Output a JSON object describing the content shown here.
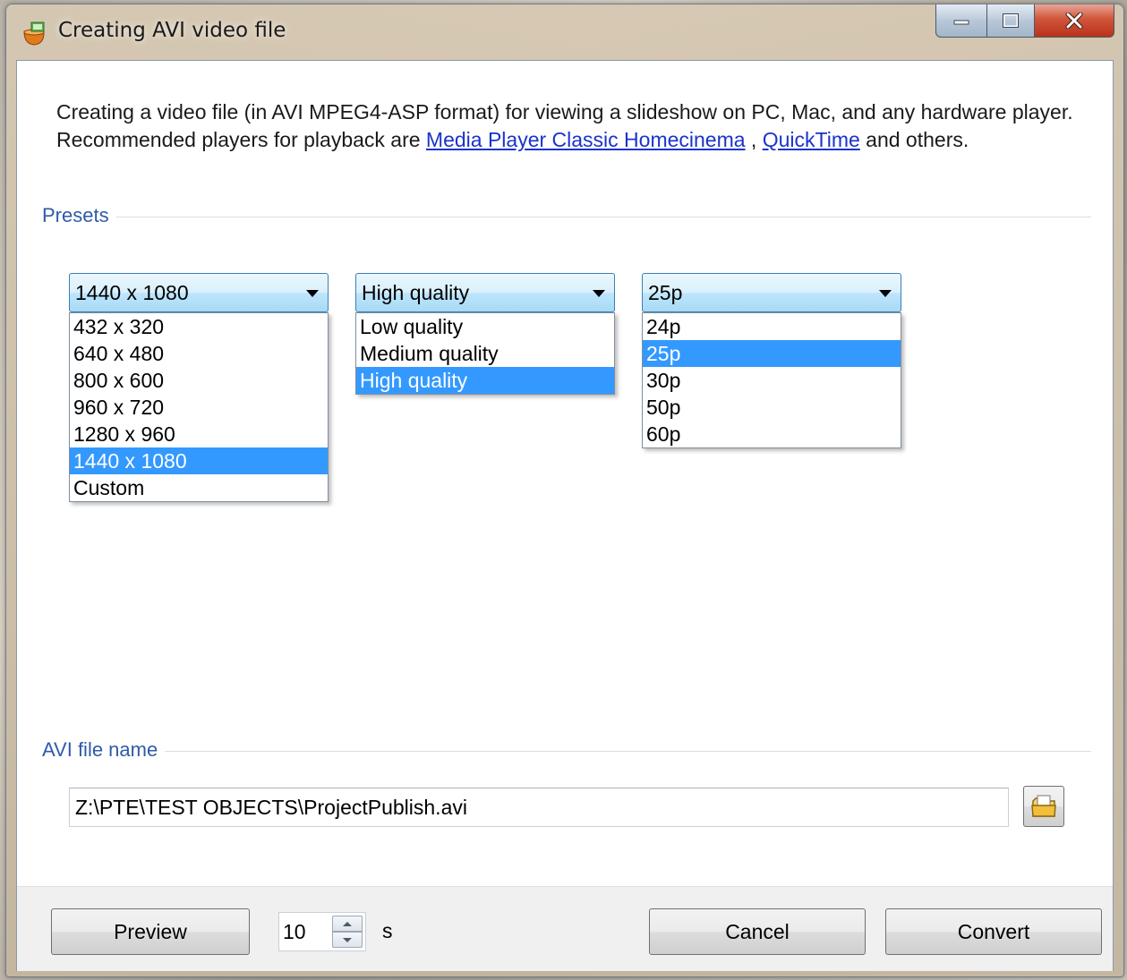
{
  "window": {
    "title": "Creating AVI video file",
    "icons": {
      "app": "avi-app-icon",
      "minimize": "minimize-icon",
      "maximize": "maximize-icon",
      "close": "close-icon"
    }
  },
  "intro": {
    "text_before": "Creating a video file (in AVI MPEG4-ASP format) for viewing a slideshow on PC, Mac, and any hardware player. Recommended players for playback are ",
    "link1": "Media Player Classic Homecinema",
    "sep": " , ",
    "link2": "QuickTime",
    "text_after": " and others."
  },
  "presets": {
    "label": "Presets",
    "resolution": {
      "selected": "1440 x 1080",
      "options": [
        "432 x 320",
        "640 x 480",
        "800 x 600",
        "960 x 720",
        "1280 x 960",
        "1440 x 1080",
        "Custom"
      ]
    },
    "quality": {
      "selected": "High quality",
      "options": [
        "Low quality",
        "Medium quality",
        "High quality"
      ]
    },
    "framerate": {
      "selected": "25p",
      "options": [
        "24p",
        "25p",
        "30p",
        "50p",
        "60p"
      ]
    }
  },
  "avi_file": {
    "label": "AVI file name",
    "value": "Z:\\PTE\\TEST OBJECTS\\ProjectPublish.avi",
    "browse_icon": "folder-open-icon"
  },
  "footer": {
    "preview_label": "Preview",
    "duration_value": "10",
    "duration_unit": "s",
    "cancel_label": "Cancel",
    "convert_label": "Convert"
  },
  "colors": {
    "accent": "#3399ff",
    "link": "#1a33cc",
    "group_label": "#2f5ba8"
  }
}
